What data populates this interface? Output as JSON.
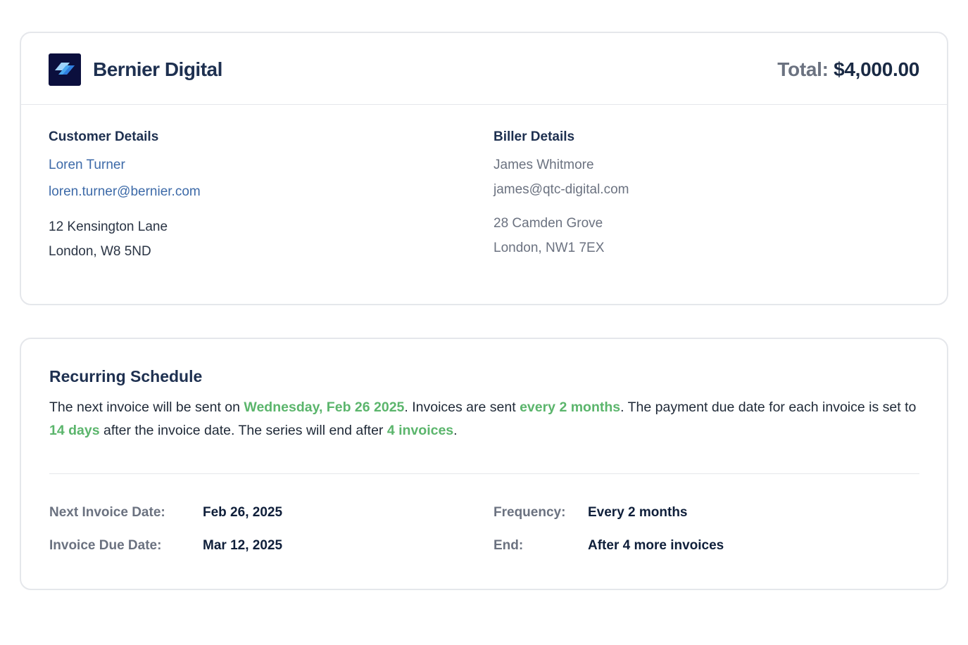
{
  "header": {
    "brand_name": "Bernier Digital",
    "total_label": "Total:",
    "total_value": "$4,000.00",
    "logo_icon": "bernier-diamond-logo",
    "logo_bg": "#0b0f3d",
    "logo_accent": "#4aa8f0"
  },
  "customer": {
    "title": "Customer Details",
    "name": "Loren Turner",
    "email": "loren.turner@bernier.com",
    "address_line1": "12 Kensington Lane",
    "address_line2": "London, W8 5ND"
  },
  "biller": {
    "title": "Biller Details",
    "name": "James Whitmore",
    "email": "james@qtc-digital.com",
    "address_line1": "28 Camden Grove",
    "address_line2": "London, NW1 7EX"
  },
  "schedule": {
    "title": "Recurring Schedule",
    "text_1": "The next invoice will be sent on ",
    "next_date_long": "Wednesday, Feb 26 2025",
    "text_2": ". Invoices are sent ",
    "frequency_text": "every 2 months",
    "text_3": ". The payment due date for each invoice is set to ",
    "due_days": "14 days",
    "text_4": " after the invoice date. The series will end after ",
    "invoice_count": "4 invoices",
    "text_5": ".",
    "highlight_color": "#5bb56c",
    "next_invoice_label": "Next Invoice Date:",
    "next_invoice_value": "Feb 26, 2025",
    "due_date_label": "Invoice Due Date:",
    "due_date_value": "Mar 12, 2025",
    "frequency_label": "Frequency:",
    "frequency_value": "Every 2 months",
    "end_label": "End:",
    "end_value": "After 4 more invoices"
  }
}
